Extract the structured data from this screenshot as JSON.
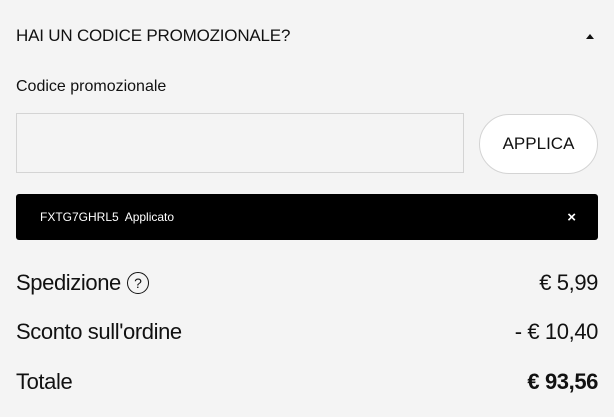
{
  "promo": {
    "header_title": "HAI UN CODICE PROMOZIONALE?",
    "label": "Codice promozionale",
    "input_value": "",
    "apply_label": "APPLICA",
    "applied_code": "FXTG7GHRL5",
    "applied_status": "Applicato",
    "remove_symbol": "×"
  },
  "summary": {
    "shipping_label": "Spedizione",
    "shipping_help_symbol": "?",
    "shipping_value": "€ 5,99",
    "discount_label": "Sconto sull'ordine",
    "discount_value": "- € 10,40",
    "total_label": "Totale",
    "total_value": "€ 93,56"
  },
  "icons": {
    "collapse": "chevron-up-icon",
    "remove": "close-icon",
    "help": "help-icon"
  },
  "colors": {
    "background": "#f4f4f4",
    "banner": "#000000",
    "text": "#111111"
  }
}
